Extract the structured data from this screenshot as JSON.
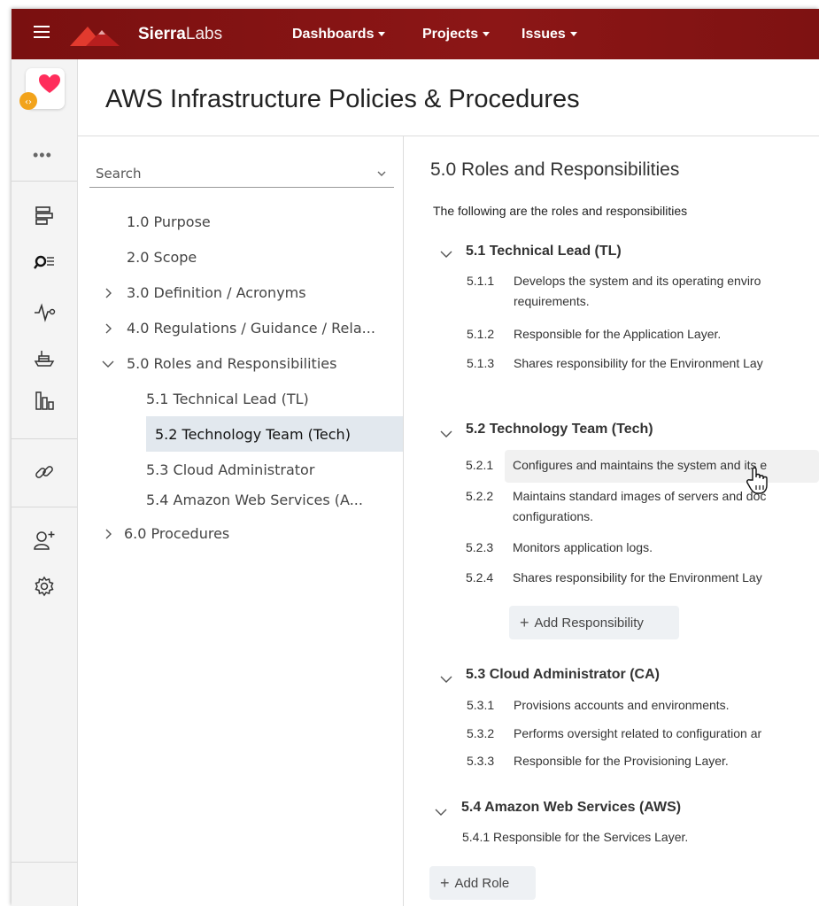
{
  "topbar": {
    "brand_bold": "Sierra",
    "brand_light": "Labs",
    "nav": [
      "Dashboards",
      "Projects",
      "Issues"
    ]
  },
  "page": {
    "title": "AWS Infrastructure Policies & Procedures"
  },
  "outline": {
    "search_placeholder": "Search",
    "items": [
      {
        "label": "1.0 Purpose"
      },
      {
        "label": "2.0 Scope"
      },
      {
        "label": "3.0 Definition / Acronyms",
        "state": "collapsed"
      },
      {
        "label": "4.0 Regulations / Guidance / Rela...",
        "state": "collapsed"
      },
      {
        "label": "5.0 Roles and Responsibilities",
        "state": "expanded"
      },
      {
        "label": "5.1 Technical Lead (TL)"
      },
      {
        "label": "5.2 Technology Team (Tech)",
        "selected": true
      },
      {
        "label": "5.3 Cloud Administrator"
      },
      {
        "label": "5.4 Amazon Web Services (A..."
      },
      {
        "label": "6.0 Procedures",
        "state": "collapsed"
      }
    ]
  },
  "content": {
    "title": "5.0 Roles and Responsibilities",
    "intro": "The following are the roles and responsibilities",
    "roles": [
      {
        "heading": "5.1 Technical Lead (TL)",
        "items": [
          {
            "num": "5.1.1",
            "text": "Develops the system and its operating enviro",
            "text2": "requirements."
          },
          {
            "num": "5.1.2",
            "text": "Responsible for the Application Layer."
          },
          {
            "num": "5.1.3",
            "text": "Shares responsibility for the Environment Lay"
          }
        ]
      },
      {
        "heading": "5.2 Technology Team (Tech)",
        "items": [
          {
            "num": "5.2.1",
            "text": "Configures and maintains the system and its e"
          },
          {
            "num": "5.2.2",
            "text": "Maintains standard images of servers and doc",
            "text2": "configurations."
          },
          {
            "num": "5.2.3",
            "text": "Monitors application logs."
          },
          {
            "num": "5.2.4",
            "text": "Shares responsibility for the Environment Lay"
          }
        ],
        "add_label": "Add Responsibility"
      },
      {
        "heading": "5.3 Cloud Administrator (CA)",
        "items": [
          {
            "num": "5.3.1",
            "text": "Provisions accounts and environments."
          },
          {
            "num": "5.3.2",
            "text": "Performs oversight related to configuration ar"
          },
          {
            "num": "5.3.3",
            "text": "Responsible for the Provisioning Layer."
          }
        ]
      },
      {
        "heading": "5.4 Amazon Web Services (AWS)",
        "items": [
          {
            "num": "5.4.1",
            "text": "Responsible for the Services Layer."
          }
        ]
      }
    ],
    "add_role_label": "Add Role"
  },
  "colors": {
    "topbar": "#8c1616",
    "brand_accent": "#e23a2e",
    "selected_bg": "#e2e8ee",
    "heart": "#ff2d5b",
    "badge": "#f2a31b"
  },
  "icons": [
    "menu-icon",
    "sierra-logo-icon",
    "heart-icon",
    "code-badge-icon",
    "more-dots-icon",
    "layout-icon",
    "search-list-icon",
    "activity-icon",
    "ship-icon",
    "bar-chart-icon",
    "link-icon",
    "add-user-icon",
    "gear-icon",
    "expand-sidebar-icon",
    "hand-cursor-icon"
  ]
}
